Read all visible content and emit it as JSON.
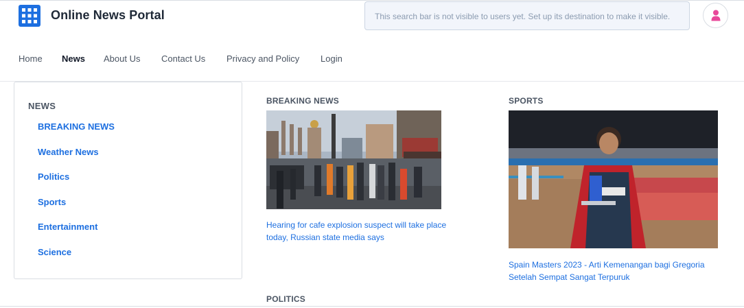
{
  "header": {
    "brand": "Online News Portal",
    "search_notice": "This search bar is not visible to users yet. Set up its destination to make it visible.",
    "logo_icon": "grid-logo-icon",
    "avatar_icon": "user-icon"
  },
  "nav": {
    "items": [
      {
        "label": "Home",
        "active": false
      },
      {
        "label": "News",
        "active": true
      },
      {
        "label": "About Us",
        "active": false
      },
      {
        "label": "Contact Us",
        "active": false
      },
      {
        "label": "Privacy and Policy",
        "active": false
      },
      {
        "label": "Login",
        "active": false
      }
    ]
  },
  "sidebar": {
    "title": "NEWS",
    "items": [
      {
        "label": "BREAKING NEWS"
      },
      {
        "label": "Weather News"
      },
      {
        "label": "Politics"
      },
      {
        "label": "Sports"
      },
      {
        "label": "Entertainment"
      },
      {
        "label": "Science"
      }
    ]
  },
  "sections": [
    {
      "label": "BREAKING NEWS",
      "image": "street-scene-emergency-image",
      "headline": "Hearing for cafe explosion suspect will take place today, Russian state media says"
    },
    {
      "label": "SPORTS",
      "image": "athlete-with-trophy-image",
      "headline": "Spain Masters 2023 - Arti Kemenangan bagi Gregoria Setelah Sempat Sangat Terpuruk"
    },
    {
      "label": "POLITICS"
    }
  ],
  "colors": {
    "accent": "#1d6fe0",
    "text_muted": "#4b5563",
    "avatar_pink": "#e8489a",
    "notice_bg": "#f2f5fb"
  }
}
